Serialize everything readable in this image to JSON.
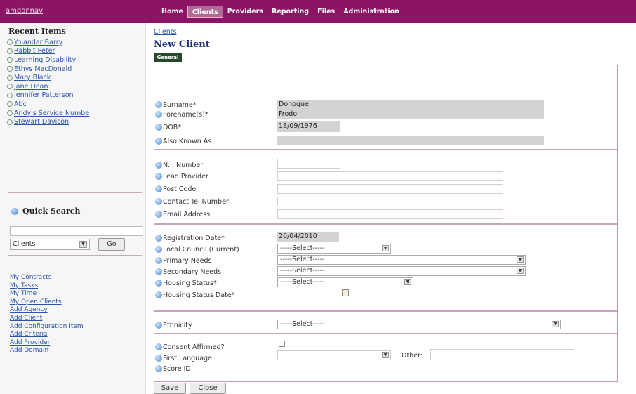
{
  "app": {
    "brand": "amdonnay",
    "nav": [
      "Home",
      "Clients",
      "Providers",
      "Reporting",
      "Files",
      "Administration"
    ],
    "active_nav": "Clients"
  },
  "sidebar": {
    "recent_title": "Recent Items",
    "recent_items": [
      "Yolandar Barry",
      "Rabbit Peter",
      "Learning Disability",
      "Ethys MacDonald",
      "Mary Black",
      "Jane Dean",
      "Jennifer Patterson",
      "Abc",
      "Andy's Service Numbe",
      "Stewart Davison"
    ],
    "quick_search_title": "Quick Search",
    "search_value": "",
    "search_type": "Clients",
    "go_label": "Go",
    "links": [
      "My Contracts",
      "My Tasks",
      "My Time",
      "My Open Clients",
      "Add Agency",
      "Add Client",
      "Add Configuration Item",
      "Add Criteria",
      "Add Provider",
      "Add Domain"
    ]
  },
  "main": {
    "breadcrumb": "Clients",
    "title": "New Client",
    "tab": "General",
    "fields": {
      "surname": {
        "label": "Surname*",
        "value": "Donogue"
      },
      "forenames": {
        "label": "Forename(s)*",
        "value": "Frodo"
      },
      "dob": {
        "label": "DOB*",
        "value": "18/09/1976"
      },
      "also_known_as": {
        "label": "Also Known As",
        "value": ""
      },
      "ni_number": {
        "label": "N.I. Number",
        "value": ""
      },
      "lead_provider": {
        "label": "Lead Provider",
        "value": ""
      },
      "post_code": {
        "label": "Post Code",
        "value": ""
      },
      "contact_tel": {
        "label": "Contact Tel Number",
        "value": ""
      },
      "email": {
        "label": "Email Address",
        "value": ""
      },
      "registration_date": {
        "label": "Registration Date*",
        "value": "20/04/2010"
      },
      "local_council": {
        "label": "Local Council (Current)",
        "value": "-----Select-----"
      },
      "primary_needs": {
        "label": "Primary Needs",
        "value": "-----Select-----"
      },
      "secondary_needs": {
        "label": "Secondary Needs",
        "value": "-----Select-----"
      },
      "housing_status": {
        "label": "Housing Status*",
        "value": "-----Select-----"
      },
      "housing_status_date": {
        "label": "Housing Status Date*",
        "value": ""
      },
      "ethnicity": {
        "label": "Ethnicity",
        "value": "-----Select-----"
      },
      "consent": {
        "label": "Consent Affirmed?",
        "checked": false
      },
      "first_language": {
        "label": "First Language",
        "value": ""
      },
      "other_label": "Other:",
      "other_value": "",
      "score_id": {
        "label": "Score ID",
        "value": ""
      }
    },
    "buttons": {
      "save": "Save",
      "close": "Close"
    }
  },
  "colors": {
    "topbar": "#8b1464",
    "title": "#1f2f7a",
    "link": "#2a55a8",
    "tab": "#254a2a",
    "border": "#c996b1"
  }
}
